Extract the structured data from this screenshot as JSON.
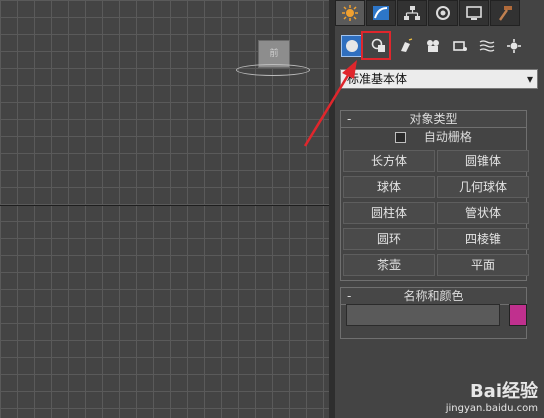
{
  "viewport": {
    "viewcube_label": "前"
  },
  "command_panel": {
    "tabs": [
      {
        "icon": "create-icon",
        "active": true
      },
      {
        "icon": "modify-icon"
      },
      {
        "icon": "hierarchy-icon"
      },
      {
        "icon": "motion-icon"
      },
      {
        "icon": "display-icon"
      },
      {
        "icon": "utilities-icon"
      }
    ],
    "subtools": [
      {
        "icon": "geometry-icon",
        "active": true
      },
      {
        "icon": "shapes-icon",
        "highlighted": true
      },
      {
        "icon": "lights-icon"
      },
      {
        "icon": "cameras-icon"
      },
      {
        "icon": "helpers-icon"
      },
      {
        "icon": "space-warps-icon"
      },
      {
        "icon": "systems-icon"
      }
    ],
    "category_dropdown": {
      "value": "标准基本体"
    },
    "object_type": {
      "title": "对象类型",
      "toggle": "-",
      "autogrid_label": "自动栅格",
      "buttons": [
        "长方体",
        "圆锥体",
        "球体",
        "几何球体",
        "圆柱体",
        "管状体",
        "圆环",
        "四棱锥",
        "茶壶",
        "平面"
      ]
    },
    "name_color": {
      "title": "名称和颜色",
      "toggle": "-",
      "name_value": "",
      "color": "#c0308e"
    }
  },
  "watermark": {
    "brand": "Bai经验",
    "url": "jingyan.baidu.com"
  },
  "colors": {
    "accent_highlight": "#e0262c",
    "active_tab_blue": "#2f6fbf"
  }
}
